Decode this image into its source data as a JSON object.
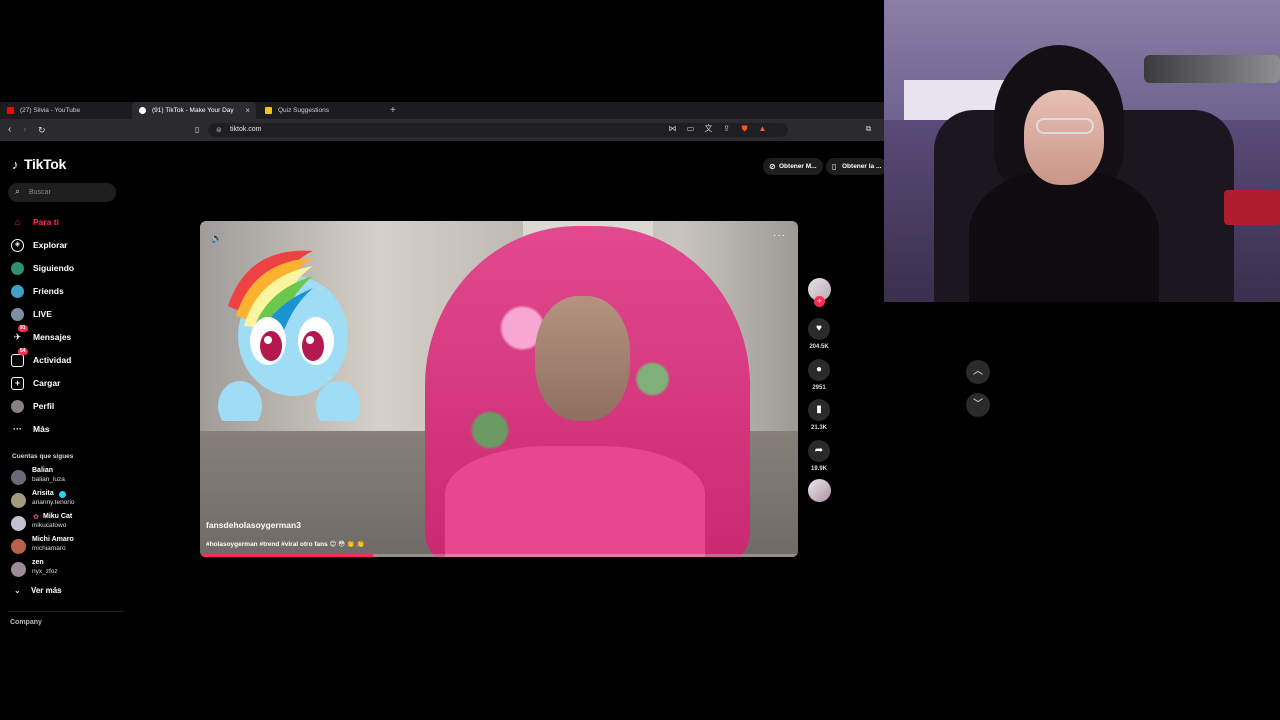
{
  "browser": {
    "tabs": [
      {
        "label": "(27) Silvia - YouTube",
        "favicon_color": "#ff0000"
      },
      {
        "label": "(91) TikTok - Make Your Day",
        "favicon_color": "#ffffff",
        "active": true
      },
      {
        "label": "Quiz Suggestions",
        "favicon_color": "#f4c21b"
      }
    ],
    "new_tab": "+",
    "tab_close": "×",
    "url": "tiktok.com"
  },
  "tiktok": {
    "logo": "TikTok",
    "search_placeholder": "Buscar",
    "nav": [
      {
        "label": "Para ti",
        "icon": "home-icon",
        "active": true
      },
      {
        "label": "Explorar",
        "icon": "compass-icon"
      },
      {
        "label": "Siguiendo",
        "icon": "following-icon"
      },
      {
        "label": "Friends",
        "icon": "friends-icon"
      },
      {
        "label": "LIVE",
        "icon": "live-icon"
      },
      {
        "label": "Mensajes",
        "icon": "messages-icon",
        "badge": "91"
      },
      {
        "label": "Actividad",
        "icon": "activity-icon",
        "badge": "54"
      },
      {
        "label": "Cargar",
        "icon": "upload-icon"
      },
      {
        "label": "Perfil",
        "icon": "profile-icon"
      },
      {
        "label": "Más",
        "icon": "more-icon"
      }
    ],
    "following_title": "Cuentas que sigues",
    "accounts": [
      {
        "name": "Balian",
        "handle": "balian_luza"
      },
      {
        "name": "Arisita",
        "handle": "arianny.tenorio"
      },
      {
        "name": "Miku Cat",
        "handle": "mikucatowo"
      },
      {
        "name": "Michi Amaro",
        "handle": "michiamaro"
      },
      {
        "name": "zen",
        "handle": "nyx_zfoz"
      }
    ],
    "see_more": "Ver más",
    "company": "Company",
    "get_buttons": [
      "Obtener M...",
      "Obtener la ..."
    ],
    "video": {
      "author": "fansdeholasoygerman3",
      "caption": "#holasoygerman #trend #viral otro fans 😊 😳 👏 👏",
      "progress": 0.29
    },
    "actions": {
      "likes": "204.5K",
      "comments": "2951",
      "saves": "21.3K",
      "shares": "19.9K"
    }
  },
  "colors": {
    "accent": "#fe2c55",
    "background": "#000000"
  }
}
